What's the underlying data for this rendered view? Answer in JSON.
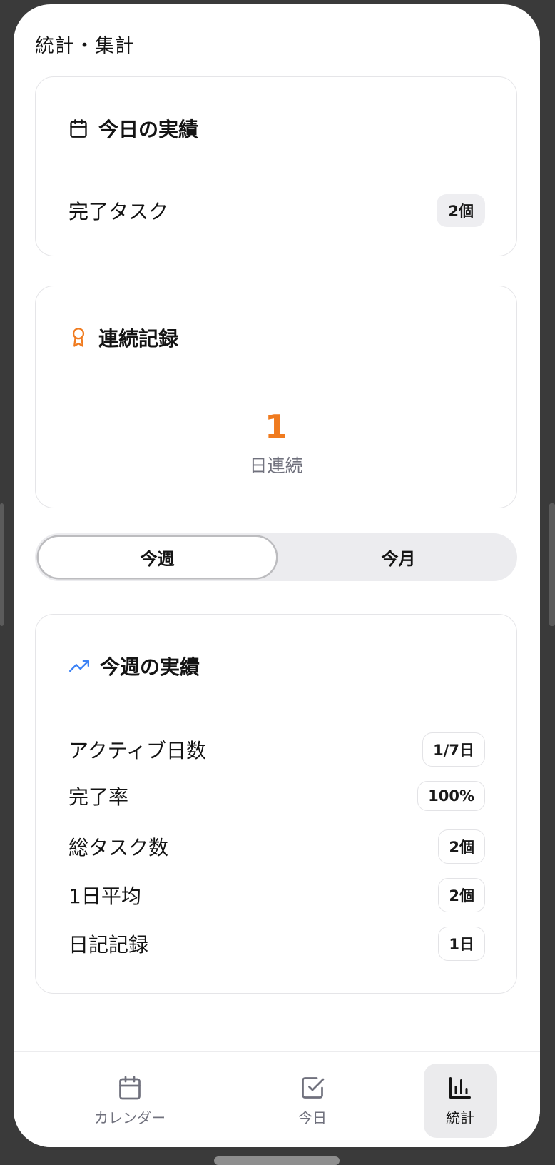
{
  "page_title": "統計・集計",
  "today_card": {
    "icon": "calendar-icon",
    "title": "今日の実績",
    "row_label": "完了タスク",
    "row_value": "2個"
  },
  "streak_card": {
    "icon": "award-icon",
    "title": "連続記録",
    "value": "1",
    "unit": "日連続",
    "accent_color": "#f07b1f"
  },
  "period_toggle": {
    "options": [
      "今週",
      "今月"
    ],
    "selected": "今週"
  },
  "week_card": {
    "icon": "trending-up-icon",
    "title": "今週の実績",
    "rows": [
      {
        "label": "アクティブ日数",
        "value": "1/7日"
      },
      {
        "label": "完了率",
        "value": "100%"
      },
      {
        "label": "総タスク数",
        "value": "2個"
      },
      {
        "label": "1日平均",
        "value": "2個"
      },
      {
        "label": "日記記録",
        "value": "1日"
      }
    ]
  },
  "tabbar": {
    "items": [
      {
        "label": "カレンダー",
        "icon": "calendar-icon"
      },
      {
        "label": "今日",
        "icon": "checkbox-icon"
      },
      {
        "label": "統計",
        "icon": "bar-chart-icon"
      }
    ],
    "active": "統計"
  }
}
